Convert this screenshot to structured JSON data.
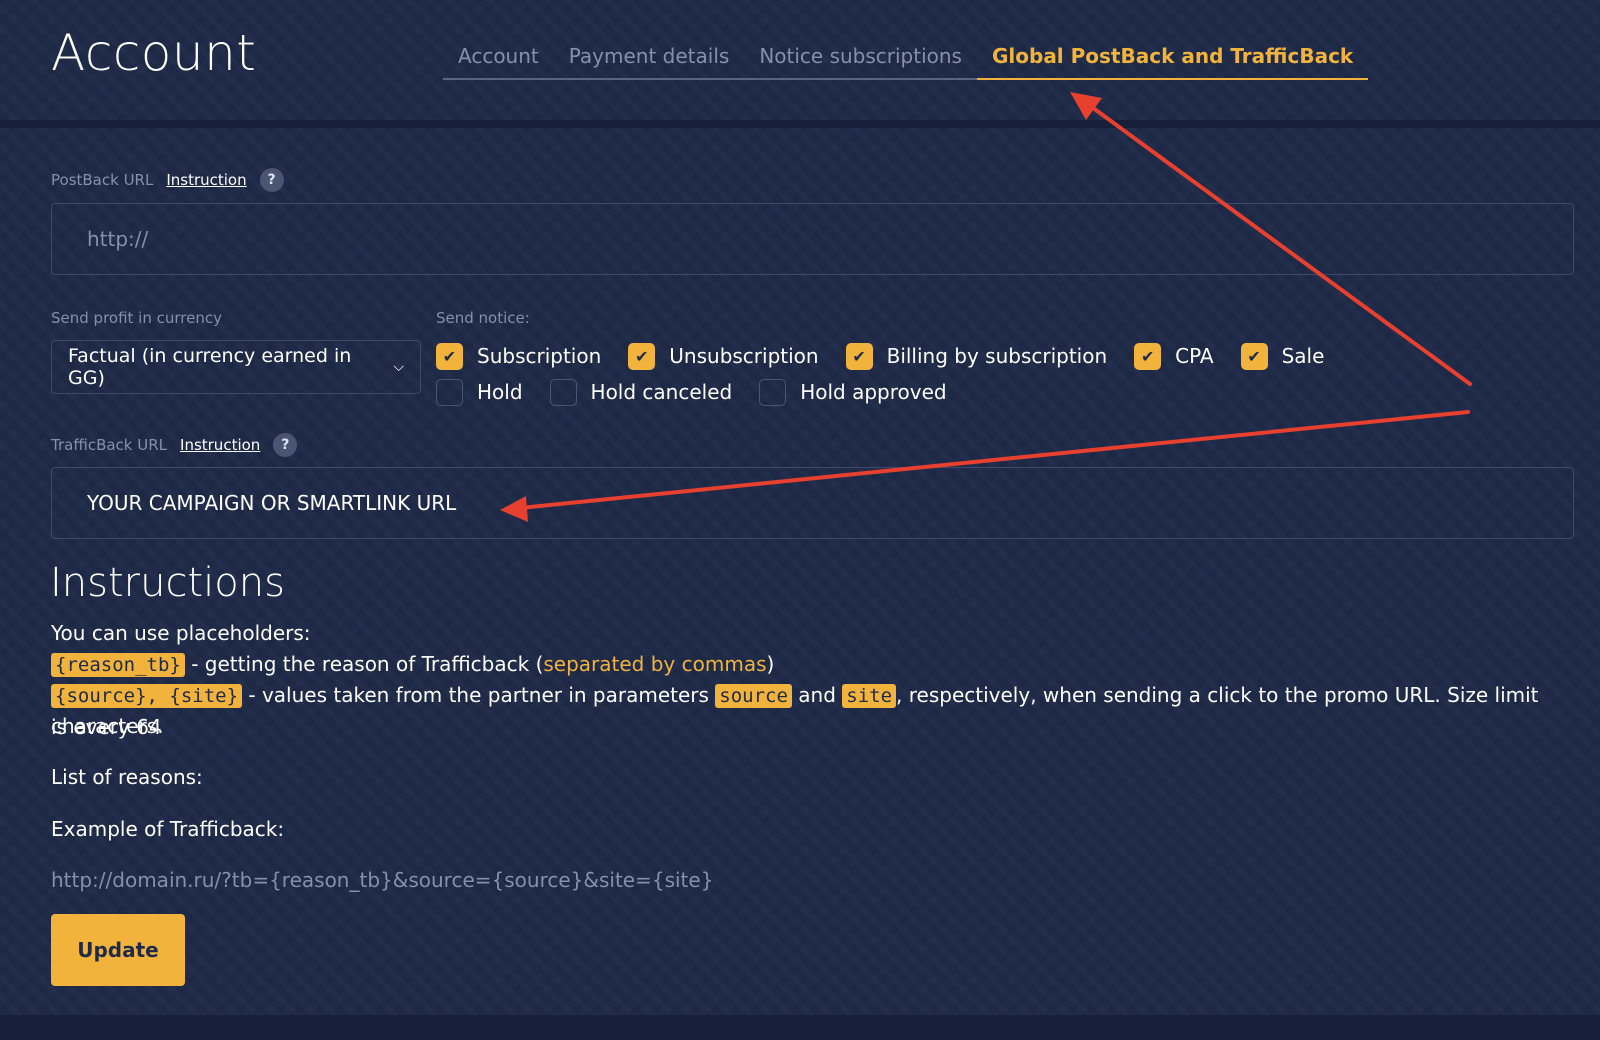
{
  "header": {
    "title": "Account",
    "tabs": [
      {
        "label": "Account",
        "active": false
      },
      {
        "label": "Payment details",
        "active": false
      },
      {
        "label": "Notice subscriptions",
        "active": false
      },
      {
        "label": "Global PostBack and TrafficBack",
        "active": true
      }
    ]
  },
  "postback": {
    "label": "PostBack URL",
    "instruction_link": "Instruction",
    "help": "?",
    "placeholder": "http://",
    "value": ""
  },
  "currency": {
    "label": "Send profit in currency",
    "selected": "Factual (in currency earned in GG)"
  },
  "notices": {
    "label": "Send notice:",
    "items": [
      {
        "label": "Subscription",
        "checked": true
      },
      {
        "label": "Unsubscription",
        "checked": true
      },
      {
        "label": "Billing by subscription",
        "checked": true
      },
      {
        "label": "CPA",
        "checked": true
      },
      {
        "label": "Sale",
        "checked": true
      },
      {
        "label": "Hold",
        "checked": false
      },
      {
        "label": "Hold canceled",
        "checked": false
      },
      {
        "label": "Hold approved",
        "checked": false
      }
    ]
  },
  "trafficback": {
    "label": "TrafficBack URL",
    "instruction_link": "Instruction",
    "help": "?",
    "value": "YOUR CAMPAIGN OR SMARTLINK URL"
  },
  "instructions": {
    "title": "Instructions",
    "intro": "You can use placeholders:",
    "reason_code": "{reason_tb}",
    "reason_text": " - getting the reason of Trafficback (",
    "reason_accent": "separated by commas",
    "reason_close": ")",
    "source_code": "{source}, {site}",
    "source_text": " - values taken from the partner in parameters ",
    "param_source": "source",
    "and_text": " and ",
    "param_site": "site",
    "source_rest": ", respectively, when sending a click to the promo URL. Size limit is every 64",
    "source_rest2": "characters.",
    "reasons_label": "List of reasons:",
    "example_label": "Example of Trafficback:",
    "example_url": "http://domain.ru/?tb={reason_tb}&source={source}&site={site}"
  },
  "actions": {
    "update_label": "Update"
  },
  "colors": {
    "background": "#1f2a48",
    "accent": "#f2b33d",
    "muted": "#8590ab",
    "arrow": "#e8402e"
  }
}
